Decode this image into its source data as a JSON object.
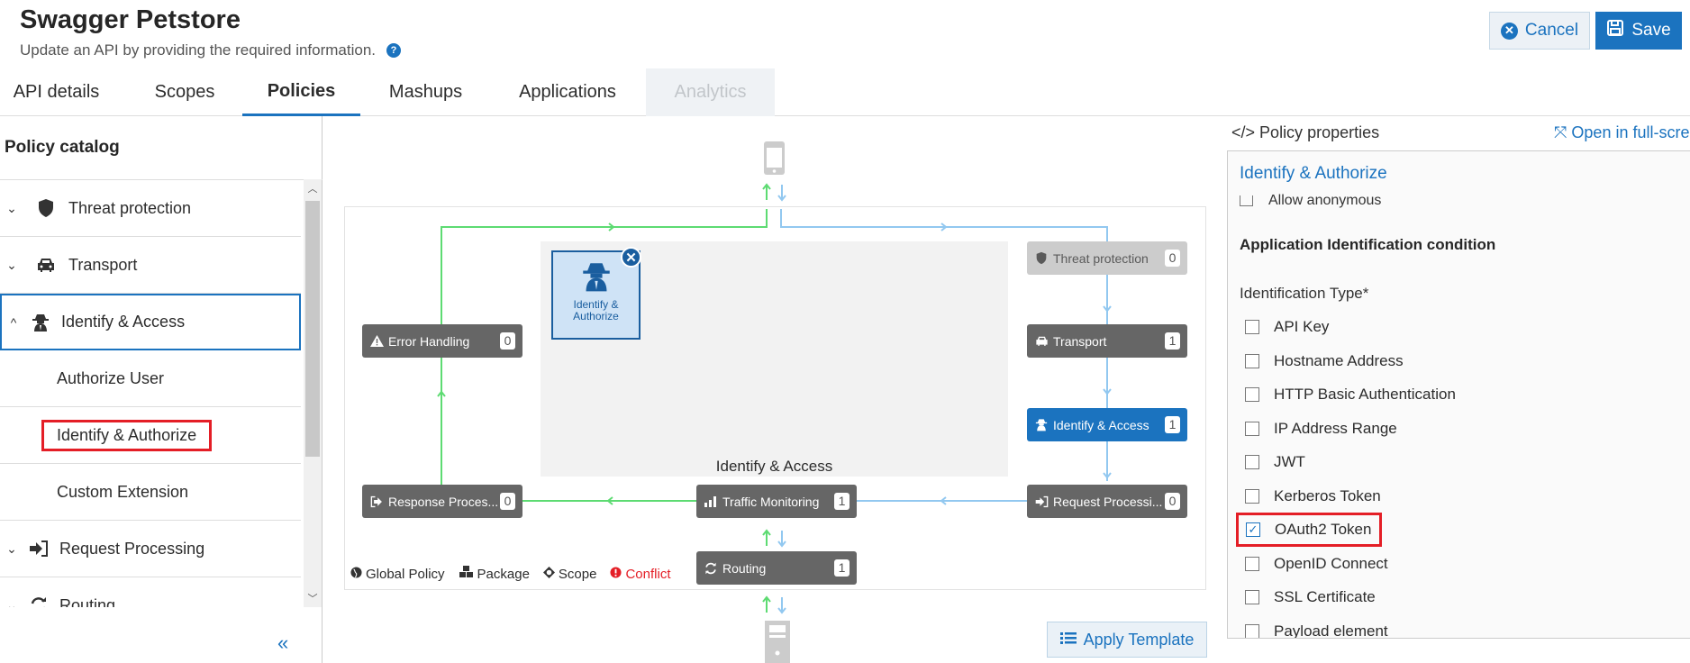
{
  "header": {
    "title": "Swagger Petstore",
    "subtitle": "Update an API by providing the required information.",
    "help_icon": "?",
    "cancel_label": "Cancel",
    "save_label": "Save"
  },
  "tabs": [
    {
      "label": "API details",
      "state": "normal"
    },
    {
      "label": "Scopes",
      "state": "normal"
    },
    {
      "label": "Policies",
      "state": "active"
    },
    {
      "label": "Mashups",
      "state": "normal"
    },
    {
      "label": "Applications",
      "state": "normal"
    },
    {
      "label": "Analytics",
      "state": "disabled"
    }
  ],
  "catalog": {
    "title": "Policy catalog",
    "items": [
      {
        "label": "Threat protection",
        "icon": "shield-icon",
        "expanded": false
      },
      {
        "label": "Transport",
        "icon": "car-icon",
        "expanded": false
      },
      {
        "label": "Identify & Access",
        "icon": "spy-icon",
        "expanded": true,
        "selected": true
      },
      {
        "label": "Authorize User",
        "sub": true
      },
      {
        "label": "Identify & Authorize",
        "sub": true,
        "highlighted": true
      },
      {
        "label": "Custom Extension",
        "sub": true
      },
      {
        "label": "Request Processing",
        "icon": "sign-in-icon",
        "expanded": false
      },
      {
        "label": "Routing",
        "icon": "refresh-icon",
        "expanded": false
      }
    ],
    "collapse_icon": "«"
  },
  "diagram": {
    "stage_label": "Identify & Access",
    "policy_card": {
      "label": "Identify & Authorize"
    },
    "nodes": {
      "threat_protection": {
        "label": "Threat protection",
        "count": "0"
      },
      "transport": {
        "label": "Transport",
        "count": "1"
      },
      "identify_access": {
        "label": "Identify & Access",
        "count": "1"
      },
      "request_processing": {
        "label": "Request Processi...",
        "count": "0"
      },
      "traffic_monitoring": {
        "label": "Traffic Monitoring",
        "count": "1"
      },
      "response_processing": {
        "label": "Response Proces...",
        "count": "0"
      },
      "error_handling": {
        "label": "Error Handling",
        "count": "0"
      },
      "routing": {
        "label": "Routing",
        "count": "1"
      }
    },
    "legend": {
      "global": "Global Policy",
      "package": "Package",
      "scope": "Scope",
      "conflict": "Conflict"
    },
    "colors": {
      "response_flow": "#5ddb72",
      "request_flow": "#92c8f0",
      "conflict": "#e41e26",
      "accent": "#1b73bf"
    },
    "apply_template_label": "Apply Template"
  },
  "properties": {
    "heading": "Policy properties",
    "fullscreen_label": "Open in full-scre",
    "policy_title": "Identify & Authorize",
    "allow_anonymous": {
      "label": "Allow anonymous",
      "checked": false
    },
    "section_title": "Application Identification condition",
    "identification_type_label": "Identification Type*",
    "options": [
      {
        "label": "API Key",
        "checked": false
      },
      {
        "label": "Hostname Address",
        "checked": false
      },
      {
        "label": "HTTP Basic Authentication",
        "checked": false
      },
      {
        "label": "IP Address Range",
        "checked": false
      },
      {
        "label": "JWT",
        "checked": false
      },
      {
        "label": "Kerberos Token",
        "checked": false
      },
      {
        "label": "OAuth2 Token",
        "checked": true,
        "highlighted": true
      },
      {
        "label": "OpenID Connect",
        "checked": false
      },
      {
        "label": "SSL Certificate",
        "checked": false
      },
      {
        "label": "Payload element",
        "checked": false
      }
    ]
  }
}
